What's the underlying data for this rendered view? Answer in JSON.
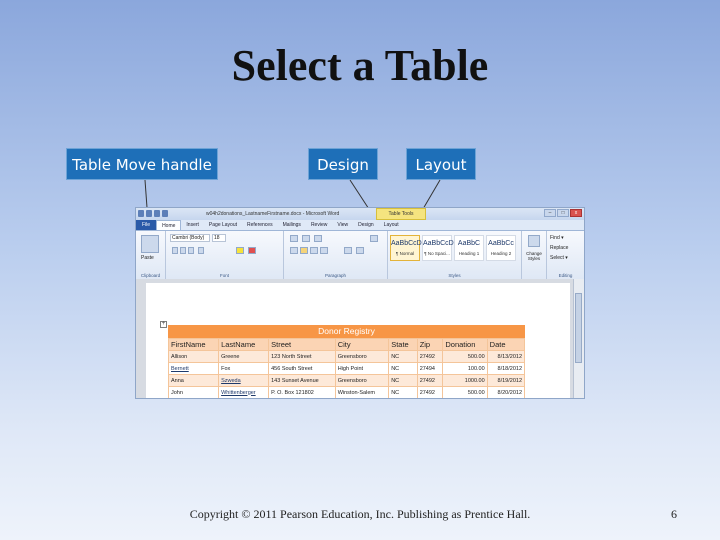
{
  "slide": {
    "title": "Select a Table",
    "callouts": [
      "Table Move handle",
      "Design",
      "Layout"
    ],
    "footer": "Copyright © 2011 Pearson Education, Inc. Publishing as Prentice Hall.",
    "page_number": "6"
  },
  "word": {
    "window_title": "w04h2donations_LastnameFirstname.docx - Microsoft Word",
    "contextual_tab": "Table Tools",
    "window_buttons": [
      "–",
      "□",
      "x"
    ],
    "tabs": [
      "File",
      "Home",
      "Insert",
      "Page Layout",
      "References",
      "Mailings",
      "Review",
      "View",
      "Design",
      "Layout"
    ],
    "active_tab": "Home",
    "font_name": "Cambri (Body)",
    "font_size": "18",
    "groups": [
      "Clipboard",
      "Font",
      "Paragraph",
      "Styles",
      "Editing"
    ],
    "paste_label": "Paste",
    "styles": [
      {
        "preview": "AaBbCcDc",
        "name": "¶ Normal",
        "selected": true
      },
      {
        "preview": "AaBbCcDc",
        "name": "¶ No Spaci...",
        "selected": false
      },
      {
        "preview": "AaBbC",
        "name": "Heading 1",
        "selected": false
      },
      {
        "preview": "AaBbCc",
        "name": "Heading 2",
        "selected": false
      }
    ],
    "change_styles_label": "Change Styles",
    "editing_items": [
      "Find ▾",
      "Replace",
      "Select ▾"
    ],
    "move_handle_glyph": "+"
  },
  "table": {
    "title": "Donor Registry",
    "headers": [
      "FirstName",
      "LastName",
      "Street",
      "City",
      "State",
      "Zip",
      "Donation",
      "Date"
    ],
    "rows": [
      [
        "Allison",
        "Greene",
        "123 North Street",
        "Greensboro",
        "NC",
        "27492",
        "500.00",
        "8/13/2012"
      ],
      [
        "Bernett",
        "Fox",
        "456 South Street",
        "High Point",
        "NC",
        "27494",
        "100.00",
        "8/18/2012"
      ],
      [
        "Anna",
        "Szweda",
        "143 Sunset Avenue",
        "Greensboro",
        "NC",
        "27492",
        "1000.00",
        "8/19/2012"
      ],
      [
        "John",
        "Whittenberger",
        "P. O. Box 121802",
        "Winston-Salem",
        "NC",
        "27492",
        "500.00",
        "8/20/2012"
      ]
    ]
  }
}
